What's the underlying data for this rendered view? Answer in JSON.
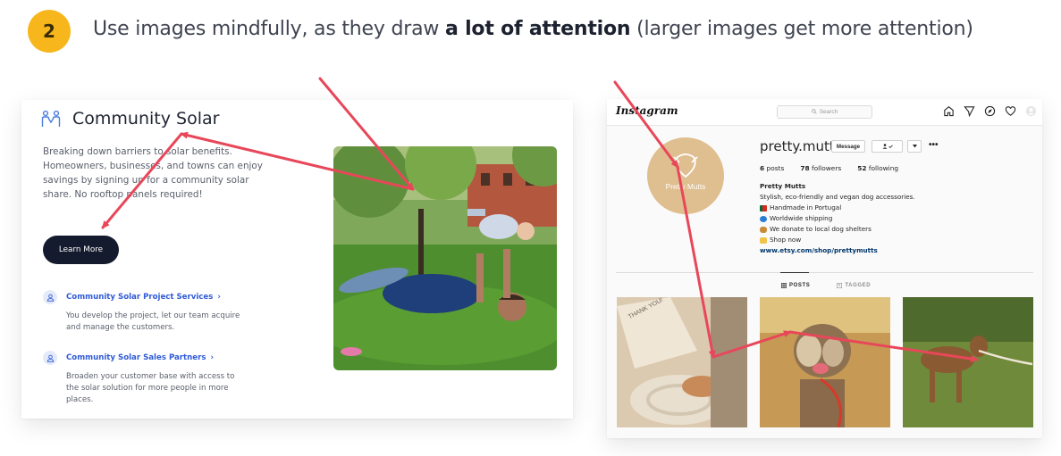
{
  "header": {
    "step_number": "2",
    "headline_pre": "Use images mindfully, as they draw ",
    "headline_bold": "a lot of attention",
    "headline_post": " (larger images get more attention)"
  },
  "community_solar": {
    "title": "Community Solar",
    "description": "Breaking down barriers to solar benefits. Homeowners, businesses, and towns can enjoy savings by signing up for a community solar share. No rooftop panels required!",
    "learn_more_label": "Learn More",
    "links": [
      {
        "label": "Community Solar Project Services",
        "chevron": "›",
        "description": "You develop the project, let our team acquire and manage the customers."
      },
      {
        "label": "Community Solar Sales Partners",
        "chevron": "›",
        "description": "Broaden your customer base with access to the solar solution for more people in more places."
      }
    ]
  },
  "instagram": {
    "logo": "Instagram",
    "search_placeholder": "Search",
    "username": "pretty.mutts",
    "message_button": "Message",
    "avatar_label": "Pretty Mutts",
    "stats": {
      "posts_count": "6",
      "posts_label": "posts",
      "followers_count": "78",
      "followers_label": "followers",
      "following_count": "52",
      "following_label": "following"
    },
    "bio": {
      "name": "Pretty Mutts",
      "tagline": "Stylish, eco-friendly and vegan dog accessories.",
      "line1": "Handmade in Portugal",
      "line2": "Worldwide shipping",
      "line3": "We donate to local dog shelters",
      "line4": "Shop now",
      "link": "www.etsy.com/shop/prettymutts"
    },
    "tabs": {
      "posts": "POSTS",
      "tagged": "TAGGED"
    },
    "post1_box_text": "THANK YOU!"
  },
  "colors": {
    "badge": "#f7b71c",
    "arrow": "#e8475a",
    "button_dark": "#151b2e",
    "link_blue": "#2f5bd6"
  }
}
